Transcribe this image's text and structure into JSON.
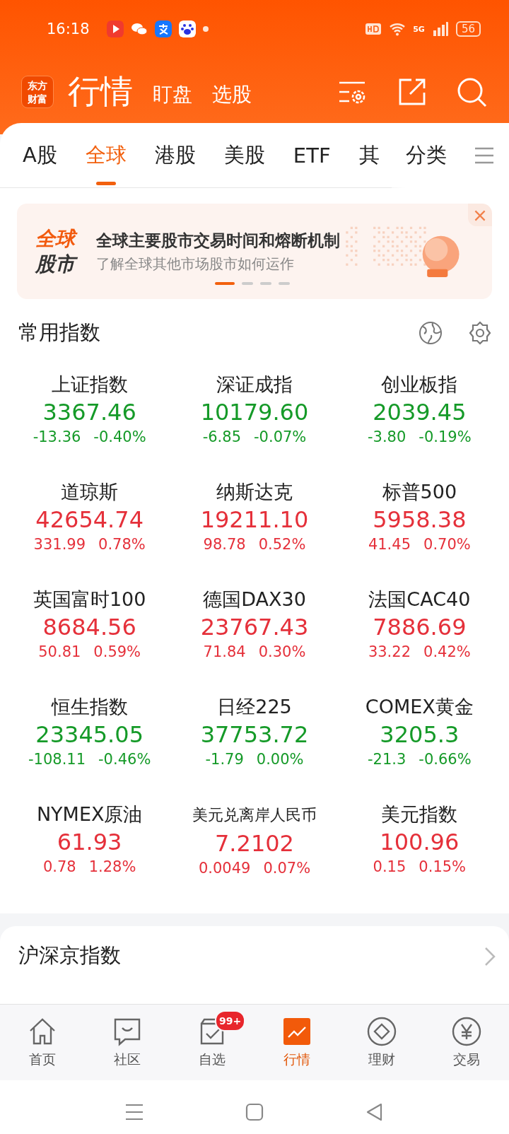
{
  "status_bar": {
    "time": "16:18",
    "network": "5G",
    "battery": "56"
  },
  "header": {
    "logo": "东方财富",
    "tabs": [
      {
        "label": "行情",
        "selected": true
      },
      {
        "label": "盯盘",
        "selected": false
      },
      {
        "label": "选股",
        "selected": false
      }
    ]
  },
  "market_tabs": [
    {
      "label": "A股",
      "selected": false
    },
    {
      "label": "全球",
      "selected": true
    },
    {
      "label": "港股",
      "selected": false
    },
    {
      "label": "美股",
      "selected": false
    },
    {
      "label": "ETF",
      "selected": false
    },
    {
      "label": "其",
      "selected": false
    }
  ],
  "category_button": "分类",
  "banner": {
    "tag_top": "全球",
    "tag_bottom": "股市",
    "title": "全球主要股市交易时间和熔断机制",
    "subtitle": "了解全球其他市场股市如何运作",
    "dots": [
      {
        "selected": true
      },
      {
        "selected": false
      },
      {
        "selected": false
      },
      {
        "selected": false
      }
    ]
  },
  "common_indices": {
    "title": "常用指数",
    "items": [
      {
        "name": "上证指数",
        "value": "3367.46",
        "change": "-13.36",
        "percent": "-0.40%",
        "kind": "down"
      },
      {
        "name": "深证成指",
        "value": "10179.60",
        "change": "-6.85",
        "percent": "-0.07%",
        "kind": "down"
      },
      {
        "name": "创业板指",
        "value": "2039.45",
        "change": "-3.80",
        "percent": "-0.19%",
        "kind": "down"
      },
      {
        "name": "道琼斯",
        "value": "42654.74",
        "change": "331.99",
        "percent": "0.78%",
        "kind": "up"
      },
      {
        "name": "纳斯达克",
        "value": "19211.10",
        "change": "98.78",
        "percent": "0.52%",
        "kind": "up"
      },
      {
        "name": "标普500",
        "value": "5958.38",
        "change": "41.45",
        "percent": "0.70%",
        "kind": "up"
      },
      {
        "name": "英国富时100",
        "value": "8684.56",
        "change": "50.81",
        "percent": "0.59%",
        "kind": "up"
      },
      {
        "name": "德国DAX30",
        "value": "23767.43",
        "change": "71.84",
        "percent": "0.30%",
        "kind": "up"
      },
      {
        "name": "法国CAC40",
        "value": "7886.69",
        "change": "33.22",
        "percent": "0.42%",
        "kind": "up"
      },
      {
        "name": "恒生指数",
        "value": "23345.05",
        "change": "-108.11",
        "percent": "-0.46%",
        "kind": "down"
      },
      {
        "name": "日经225",
        "value": "37753.72",
        "change": "-1.79",
        "percent": "0.00%",
        "kind": "down"
      },
      {
        "name": "COMEX黄金",
        "value": "3205.3",
        "change": "-21.3",
        "percent": "-0.66%",
        "kind": "down"
      },
      {
        "name": "NYMEX原油",
        "value": "61.93",
        "change": "0.78",
        "percent": "1.28%",
        "kind": "up"
      },
      {
        "name": "美元兑离岸人民币",
        "value": "7.2102",
        "change": "0.0049",
        "percent": "0.07%",
        "kind": "up"
      },
      {
        "name": "美元指数",
        "value": "100.96",
        "change": "0.15",
        "percent": "0.15%",
        "kind": "up"
      }
    ]
  },
  "section_link": {
    "title": "沪深京指数"
  },
  "bottom_nav": [
    {
      "label": "首页",
      "kind": "home",
      "selected": false
    },
    {
      "label": "社区",
      "kind": "chat",
      "selected": false
    },
    {
      "label": "自选",
      "kind": "check",
      "selected": false,
      "badge": "99+"
    },
    {
      "label": "行情",
      "kind": "chart",
      "selected": true
    },
    {
      "label": "理财",
      "kind": "diamond",
      "selected": false
    },
    {
      "label": "交易",
      "kind": "yen",
      "selected": false
    }
  ]
}
